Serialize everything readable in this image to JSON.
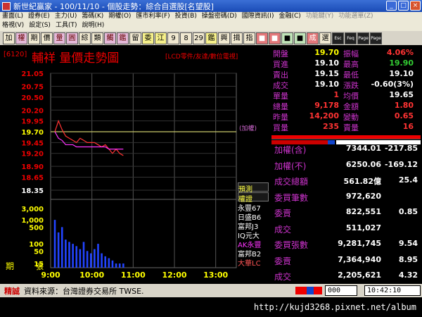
{
  "window": {
    "title": "新世紀贏家 - 100/11/10 - 個股走勢：綜合自選股[名望股]",
    "btn_min": "_",
    "btn_max": "□",
    "btn_close": "×"
  },
  "menu": {
    "row1": [
      "畫面(L)",
      "證券(E)",
      "主力(U)",
      "籌碼(K)",
      "期權(O)",
      "匯市利率(F)",
      "投資(B)",
      "操盤密碼(D)",
      "國際資訊(I)",
      "金融(C)",
      "功能鍵(Y)",
      "功能選單(Z)"
    ],
    "row2": [
      "格視(V)",
      "設定(S)",
      "工具(T)",
      "說明(H)"
    ]
  },
  "toolbar": {
    "buttons": [
      "加",
      "權",
      "期",
      "價",
      "量",
      "圓",
      "綜",
      "類",
      "觸",
      "鑑",
      "留",
      "委",
      "江",
      "9",
      "8",
      "29",
      "鑑",
      "興",
      "揖",
      "指",
      "■",
      "■",
      "■",
      "■",
      "成",
      "選",
      "Esc",
      "Feq",
      "Page",
      "Page"
    ]
  },
  "chart": {
    "code_tag": "[6120]",
    "stock_title": "輔祥  量價走勢圖",
    "source_note": "[LCD零件/友達/數位電視]",
    "price_ticks": [
      "21.05",
      "20.75",
      "20.50",
      "20.20",
      "19.95",
      "19.70",
      "19.45",
      "19.20",
      "18.90",
      "18.65",
      "18.35"
    ],
    "volume_ticks": [
      "3,000",
      "1,000",
      "500",
      "100",
      "50",
      "15"
    ],
    "volume_unit": "張",
    "period_label": "期",
    "time_ticks": [
      "9:00",
      "10:00",
      "11:00",
      "12:00",
      "13:00"
    ],
    "weighted_label": "(加權)",
    "ref_price": 19.7
  },
  "chart_data": {
    "type": "line",
    "title": "輔祥  量價走勢圖",
    "xlabel": "",
    "ylabel": "",
    "ylim": [
      18.35,
      21.05
    ],
    "x": [
      "9:00",
      "9:05",
      "9:10",
      "9:15",
      "9:20",
      "9:25",
      "9:30",
      "9:35",
      "9:40",
      "9:45",
      "9:50",
      "9:55",
      "10:00",
      "10:05",
      "10:10",
      "10:15",
      "10:20",
      "10:25",
      "10:30",
      "10:35"
    ],
    "series": [
      {
        "values": [
          19.7,
          19.95,
          19.75,
          19.6,
          19.55,
          19.5,
          19.45,
          19.55,
          19.5,
          19.45,
          19.45,
          19.45,
          19.4,
          19.35,
          19.4,
          19.3,
          19.2,
          19.3,
          19.2,
          19.15
        ]
      },
      {
        "values": [
          19.7,
          19.55,
          19.5,
          19.4,
          19.4,
          19.4,
          19.35,
          19.35,
          19.35,
          19.35,
          19.35,
          19.35,
          19.35,
          19.35,
          19.35,
          19.3,
          19.3,
          19.3,
          19.3,
          19.3
        ]
      }
    ],
    "volume": [
      1000,
      300,
      500,
      150,
      120,
      100,
      80,
      60,
      120,
      50,
      40,
      60,
      100,
      40,
      30,
      25,
      20,
      15,
      15,
      15
    ]
  },
  "brokers": {
    "boxed": [
      "預測",
      "權證"
    ],
    "list": [
      {
        "name": "永豐67",
        "color": "white"
      },
      {
        "name": "日盛B6",
        "color": "white"
      },
      {
        "name": "富邦J3",
        "color": "white"
      },
      {
        "name": "IQ元大",
        "color": "white"
      },
      {
        "name": "AK永豐",
        "color": "pink"
      },
      {
        "name": "富邦B2",
        "color": "white"
      },
      {
        "name": "大華LC",
        "color": "red"
      }
    ]
  },
  "quote": [
    {
      "lab1": "開盤",
      "val1": "19.70",
      "c1": "#ff0",
      "lab2": "振幅",
      "val2": "4.06%",
      "c2": "#f33"
    },
    {
      "lab1": "買進",
      "val1": "19.10",
      "c1": "#fff",
      "lab2": "最高",
      "val2": "19.90",
      "c2": "#3c3"
    },
    {
      "lab1": "賣出",
      "val1": "19.15",
      "c1": "#fff",
      "lab2": "最低",
      "val2": "19.10",
      "c2": "#fff"
    },
    {
      "lab1": "成交",
      "val1": "19.10",
      "c1": "#fff",
      "lab2": "漲跌",
      "val2": "-0.60(3%)",
      "c2": "#fff"
    },
    {
      "lab1": "單量",
      "val1": "1",
      "c1": "#f33",
      "lab2": "均價",
      "val2": "19.65",
      "c2": "#fff"
    },
    {
      "lab1": "總量",
      "val1": "9,178",
      "c1": "#f33",
      "lab2": "金額",
      "val2": "1.80",
      "c2": "#f33"
    },
    {
      "lab1": "昨量",
      "val1": "14,200",
      "c1": "#f33",
      "lab2": "變動",
      "val2": "0.65",
      "c2": "#f33"
    },
    {
      "lab1": "買量",
      "val1": "235",
      "c1": "#f33",
      "lab2": "賣量",
      "val2": "16",
      "c2": "#f33"
    }
  ],
  "market": [
    {
      "label": "加權(含)",
      "v1": "7344.01",
      "v2": "-217.85"
    },
    {
      "label": "加權(不)",
      "v1": "6250.06",
      "v2": "-169.12"
    },
    {
      "label": "成交總額",
      "v1": "561.82億",
      "v2": "25.4"
    },
    {
      "label": "委買筆數",
      "v1": "972,620",
      "v2": ""
    },
    {
      "label": "委賣",
      "v1": "822,551",
      "v2": "0.85"
    },
    {
      "label": "成交",
      "v1": "511,027",
      "v2": ""
    },
    {
      "label": "委買張數",
      "v1": "9,281,745",
      "v2": "9.54"
    },
    {
      "label": "委賣",
      "v1": "7,364,940",
      "v2": "8.95"
    },
    {
      "label": "成交",
      "v1": "2,205,621",
      "v2": "4.32"
    }
  ],
  "status": {
    "tag": "精誠",
    "source": "資料來源：台灣證券交易所 TWSE.",
    "code_input": "000",
    "time": "10:42:10"
  },
  "url": "http://kujd3268.pixnet.net/album"
}
